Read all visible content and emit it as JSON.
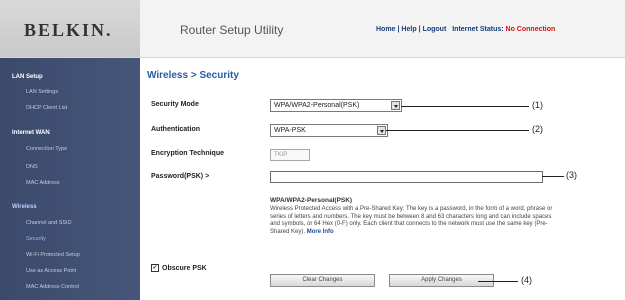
{
  "header": {
    "logo": "BELKIN",
    "logo_dot": ".",
    "title": "Router Setup Utility",
    "nav": {
      "home": "Home",
      "help": "Help",
      "logout": "Logout",
      "status_label": "Internet Status:",
      "status_value": "No Connection"
    }
  },
  "sidebar": {
    "lan_setup": "LAN Setup",
    "lan_settings": "LAN Settings",
    "dhcp_client_list": "DHCP Client List",
    "internet_wan": "Internet WAN",
    "connection_type": "Connection Type",
    "dns": "DNS",
    "mac_address": "MAC Address",
    "wireless": "Wireless",
    "channel_ssid": "Channel and SSID",
    "security": "Security",
    "wps": "Wi-Fi Protected Setup",
    "access_point": "Use as Access Point",
    "mac_control": "MAC Address Control"
  },
  "main": {
    "title": "Wireless > Security",
    "security_mode_label": "Security Mode",
    "security_mode_value": "WPA/WPA2-Personal(PSK)",
    "authentication_label": "Authentication",
    "authentication_value": "WPA-PSK",
    "encryption_label": "Encryption Technique",
    "encryption_value": "TKIP",
    "password_label": "Password(PSK) >",
    "password_value": "",
    "help_title": "WPA/WPA2-Personal(PSK)",
    "help_text": "Wireless Protected Access with a Pre-Shared Key: The key is a password, in the form of a word, phrase or series of letters and numbers. The key must be between 8 and 63 characters long and can include spaces and symbols, or 64 Hex (0-F) only. Each client that connects to the network must use the same key (Pre-Shared Key).",
    "more_info": "More Info",
    "obscure_label": "Obscure PSK",
    "obscure_checked": "✓",
    "clear_button": "Clear Changes",
    "apply_button": "Apply Changes"
  },
  "callouts": {
    "c1": "(1)",
    "c2": "(2)",
    "c3": "(3)",
    "c4": "(4)"
  }
}
